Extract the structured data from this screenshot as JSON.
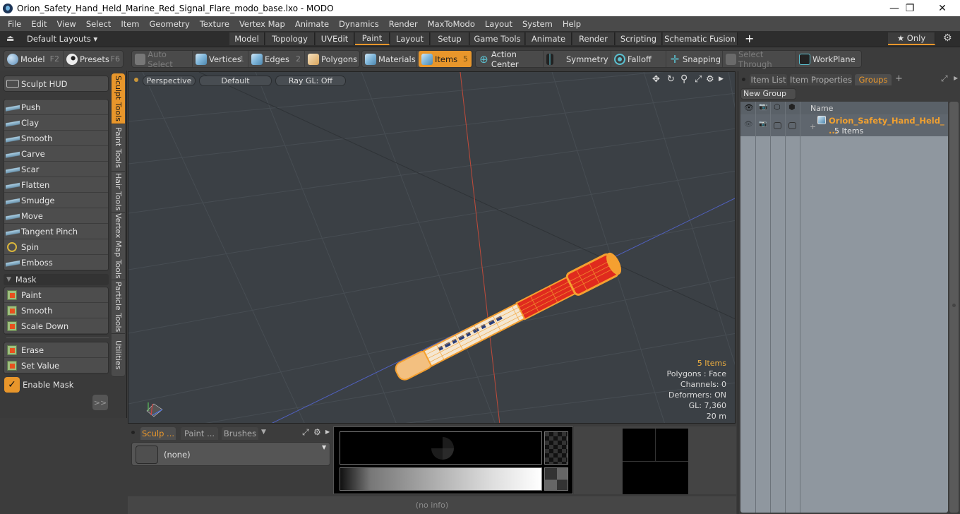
{
  "window": {
    "title": "Orion_Safety_Hand_Held_Marine_Red_Signal_Flare_modo_base.lxo - MODO",
    "controls": {
      "minimize": "—",
      "maximize": "❐",
      "close": "✕"
    }
  },
  "menu": [
    "File",
    "Edit",
    "View",
    "Select",
    "Item",
    "Geometry",
    "Texture",
    "Vertex Map",
    "Animate",
    "Dynamics",
    "Render",
    "MaxToModo",
    "Layout",
    "System",
    "Help"
  ],
  "layout_bar": {
    "layouts_label": "Default Layouts ▾",
    "tabs": [
      "Model",
      "Topology",
      "UVEdit",
      "Paint",
      "Layout",
      "Setup",
      "Game Tools",
      "Animate",
      "Render",
      "Scripting",
      "Schematic Fusion"
    ],
    "active_tab": "Paint",
    "add_label": "+",
    "only_label": "★ Only"
  },
  "toolbar": {
    "model": {
      "label": "Model",
      "key": "F2"
    },
    "presets": {
      "label": "Presets",
      "key": "F6"
    },
    "auto_select": "Auto Select",
    "vertices": {
      "label": "Vertices",
      "key": "1"
    },
    "edges": {
      "label": "Edges",
      "key": "2"
    },
    "polygons": {
      "label": "Polygons"
    },
    "materials": "Materials",
    "items": {
      "label": "Items",
      "key": "5"
    },
    "action_center": "Action Center",
    "symmetry": "Symmetry",
    "falloff": "Falloff",
    "snapping": "Snapping",
    "select_through": "Select Through",
    "workplane": "WorkPlane"
  },
  "left_panel": {
    "sculpt_hud": "Sculpt HUD",
    "tools": [
      "Push",
      "Clay",
      "Smooth",
      "Carve",
      "Scar",
      "Flatten",
      "Smudge",
      "Move",
      "Tangent Pinch",
      "Spin",
      "Emboss"
    ],
    "mask_header": "Mask",
    "mask_tools": [
      "Paint",
      "Smooth",
      "Scale Down"
    ],
    "mask_tools2": [
      "Erase",
      "Set Value"
    ],
    "enable_mask": {
      "label": "Enable Mask",
      "checked": true
    },
    "expand_label": ">>",
    "vertical_tabs": [
      "Sculpt Tools",
      "Paint Tools",
      "Hair Tools",
      "Vertex Map Tools",
      "Particle Tools",
      "Utilities"
    ],
    "active_vertical_tab": "Sculpt Tools"
  },
  "viewport": {
    "view_mode": "Perspective",
    "shading": "Default",
    "raygl": "Ray GL: Off",
    "info": {
      "items": "5 Items",
      "polygons": "Polygons : Face",
      "channels": "Channels: 0",
      "deformers": "Deformers: ON",
      "gl": "GL: 7,360",
      "scale": "20 m"
    },
    "axis_labels": {
      "x": "X",
      "y": "Y",
      "z": "Z"
    }
  },
  "right_panel": {
    "tabs": [
      "Item List",
      "Item Properties",
      "Groups"
    ],
    "active_tab": "Groups",
    "add_label": "+",
    "new_group": "New Group",
    "columns": {
      "name": "Name"
    },
    "rows": [
      {
        "name": "Orion_Safety_Hand_Held_ ...",
        "sub": "5 Items"
      }
    ]
  },
  "bottom_panel": {
    "tabs": [
      "Sculp ...",
      "Paint ...",
      "Brushes"
    ],
    "active_tab": "Sculp ...",
    "preset_value": "(none)"
  },
  "status": {
    "text": "(no info)"
  },
  "colors": {
    "accent": "#e8962b",
    "viewport_bg": "#3b4045",
    "model_red": "#e02a1e",
    "model_wire": "#f5a030"
  }
}
